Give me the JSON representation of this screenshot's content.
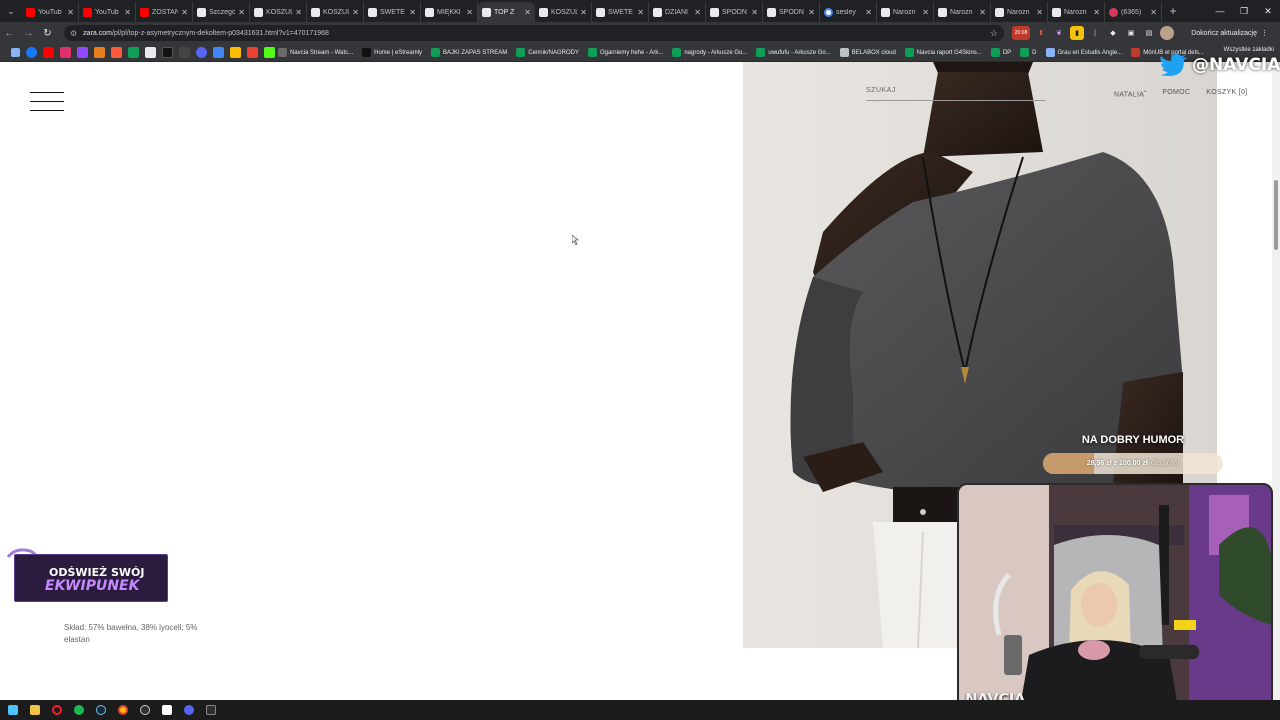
{
  "browser": {
    "tabs": [
      {
        "label": "YouTub",
        "favicon": "youtube-icon",
        "active": false
      },
      {
        "label": "YouTub",
        "favicon": "youtube-icon",
        "active": false
      },
      {
        "label": "ZOSTAŃ",
        "favicon": "youtube-icon",
        "active": false
      },
      {
        "label": "Szczegó",
        "favicon": "zara-icon",
        "active": false
      },
      {
        "label": "KOSZUL",
        "favicon": "zara-icon",
        "active": false
      },
      {
        "label": "KOSZUL",
        "favicon": "zara-icon",
        "active": false
      },
      {
        "label": "SWETE",
        "favicon": "zara-icon",
        "active": false
      },
      {
        "label": "MIĘKKI",
        "favicon": "zara-icon",
        "active": false
      },
      {
        "label": "TOP Z",
        "favicon": "zara-icon",
        "active": true
      },
      {
        "label": "KOSZUL",
        "favicon": "zara-icon",
        "active": false
      },
      {
        "label": "SWETE",
        "favicon": "zara-icon",
        "active": false
      },
      {
        "label": "DZIANI",
        "favicon": "zara-icon",
        "active": false
      },
      {
        "label": "SPODN",
        "favicon": "zara-icon",
        "active": false
      },
      {
        "label": "SPODN",
        "favicon": "zara-icon",
        "active": false
      },
      {
        "label": "sesley",
        "favicon": "google-icon",
        "active": false
      },
      {
        "label": "Narozn",
        "favicon": "zara-icon",
        "active": false
      },
      {
        "label": "Narozn",
        "favicon": "zara-icon",
        "active": false
      },
      {
        "label": "Narozn",
        "favicon": "zara-icon",
        "active": false
      },
      {
        "label": "Narozn",
        "favicon": "zara-icon",
        "active": false
      },
      {
        "label": "(6365)",
        "favicon": "twitch-icon",
        "active": false
      }
    ],
    "url_host": "zara.com",
    "url_path": "/pl/pl/top-z-asymetrycznym-dekoltem-p03431631.html?v1=470171968",
    "update_label": "Dokończ aktualizację",
    "ext_badge": "20:08",
    "bookmarks": [
      {
        "label": "Navcia Stream - Watc..."
      },
      {
        "label": "Home | eStreamly"
      },
      {
        "label": "BAJKI ZAPAS STREAM"
      },
      {
        "label": "Cennik/NAGRODY"
      },
      {
        "label": "Ogarniemy hehe - Ark..."
      },
      {
        "label": "nagrody - Arkusze Go..."
      },
      {
        "label": "uwufufu - Arkusze Go..."
      },
      {
        "label": "BELABOX cloud"
      },
      {
        "label": "Navcia raport G4Skins..."
      },
      {
        "label": "DP"
      },
      {
        "label": "D"
      },
      {
        "label": "Grau en Estudis Angle..."
      },
      {
        "label": "MónUB el portal dels..."
      }
    ],
    "all_bookmarks": "Wszystkie zakładki"
  },
  "page": {
    "search_label": "SZUKAJ",
    "nav": {
      "user": "NATALIA",
      "user_mark": "•",
      "help": "POMOC",
      "cart": "KOSZYK [0]"
    },
    "composition": "Skład: 57% bawełna, 38% lyocell; 5% elastan"
  },
  "overlay": {
    "twitter_handle": "@NAVCIA",
    "goal_title": "NA DOBRY HUMOR",
    "goal_amount": "28,36 zł z 100,00 zł",
    "goal_percent_text": "(28,36%)",
    "goal_percent": 28.36,
    "promo_line1": "ODŚWIEŻ SWÓJ",
    "promo_line2": "EKWIPUNEK",
    "webcam_name": "NAVCIA"
  },
  "colors": {
    "chrome_dark": "#202124",
    "chrome_mid": "#35363a",
    "goal_fill": "#c79a6c",
    "promo_bg": "#2a1b3f",
    "promo_accent": "#c58aff"
  }
}
